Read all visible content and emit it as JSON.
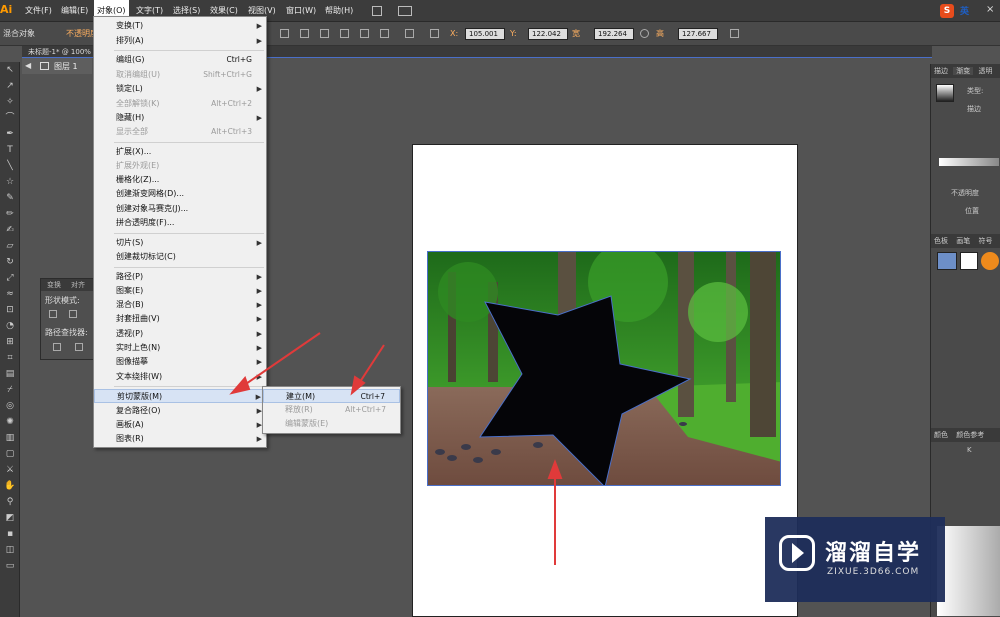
{
  "app": {
    "logo": "Ai"
  },
  "menubar": {
    "items": [
      {
        "label": "文件(F)"
      },
      {
        "label": "编辑(E)"
      },
      {
        "label": "对象(O)"
      },
      {
        "label": "文字(T)"
      },
      {
        "label": "选择(S)"
      },
      {
        "label": "效果(C)"
      },
      {
        "label": "视图(V)"
      },
      {
        "label": "窗口(W)"
      },
      {
        "label": "帮助(H)"
      }
    ],
    "ime_label": "英"
  },
  "options_bar": {
    "selection_label": "混合对象",
    "opacity_label": "不透明度",
    "x_label": "X:",
    "x_value": "105.001",
    "y_label": "Y:",
    "y_value": "122.042",
    "w_label": "宽",
    "w_value": "192.264",
    "h_label": "高",
    "h_value": "127.667"
  },
  "document": {
    "tab_label": "未标题-1* @ 100%",
    "layer_label": "图层 1"
  },
  "object_menu": {
    "items": [
      {
        "label": "变换(T)",
        "submenu": true
      },
      {
        "label": "排列(A)",
        "submenu": true
      },
      {
        "label": "编组(G)",
        "shortcut": "Ctrl+G"
      },
      {
        "label": "取消编组(U)",
        "shortcut": "Shift+Ctrl+G",
        "disabled": true
      },
      {
        "label": "锁定(L)",
        "submenu": true
      },
      {
        "label": "全部解锁(K)",
        "shortcut": "Alt+Ctrl+2",
        "disabled": true
      },
      {
        "label": "隐藏(H)",
        "submenu": true
      },
      {
        "label": "显示全部",
        "shortcut": "Alt+Ctrl+3",
        "disabled": true
      },
      {
        "label": "扩展(X)..."
      },
      {
        "label": "扩展外观(E)",
        "disabled": true
      },
      {
        "label": "栅格化(Z)..."
      },
      {
        "label": "创建渐变网格(D)..."
      },
      {
        "label": "创建对象马赛克(J)..."
      },
      {
        "label": "拼合透明度(F)..."
      },
      {
        "label": "切片(S)",
        "submenu": true
      },
      {
        "label": "创建裁切标记(C)"
      },
      {
        "label": "路径(P)",
        "submenu": true
      },
      {
        "label": "图案(E)",
        "submenu": true
      },
      {
        "label": "混合(B)",
        "submenu": true
      },
      {
        "label": "封套扭曲(V)",
        "submenu": true
      },
      {
        "label": "透视(P)",
        "submenu": true
      },
      {
        "label": "实时上色(N)",
        "submenu": true
      },
      {
        "label": "图像描摹",
        "submenu": true
      },
      {
        "label": "文本绕排(W)",
        "submenu": true
      },
      {
        "label": "剪切蒙版(M)",
        "submenu": true,
        "highlighted": true
      },
      {
        "label": "复合路径(O)",
        "submenu": true
      },
      {
        "label": "画板(A)",
        "submenu": true
      },
      {
        "label": "图表(R)",
        "submenu": true
      }
    ]
  },
  "clip_submenu": {
    "items": [
      {
        "label": "建立(M)",
        "shortcut": "Ctrl+7",
        "highlighted": true
      },
      {
        "label": "释放(R)",
        "shortcut": "Alt+Ctrl+7",
        "disabled": true
      },
      {
        "label": "编辑蒙版(E)",
        "disabled": true
      }
    ]
  },
  "float_panel": {
    "tab1": "变换",
    "tab2": "对齐",
    "shape_mode": "形状模式:",
    "pathfinder": "路径查找器:"
  },
  "right_panel": {
    "tabs_top": [
      "描边",
      "渐变",
      "透明"
    ],
    "type_label": "类型:",
    "stroke_label": "描边",
    "opacity_label": "不透明度",
    "position_label": "位置",
    "tabs_mid": [
      "色板",
      "画笔",
      "符号"
    ],
    "tabs_color": [
      "颜色",
      "颜色参考"
    ],
    "k_label": "K"
  },
  "watermark": {
    "title": "溜溜自学",
    "subtitle": "ZIXUE.3D66.COM"
  }
}
